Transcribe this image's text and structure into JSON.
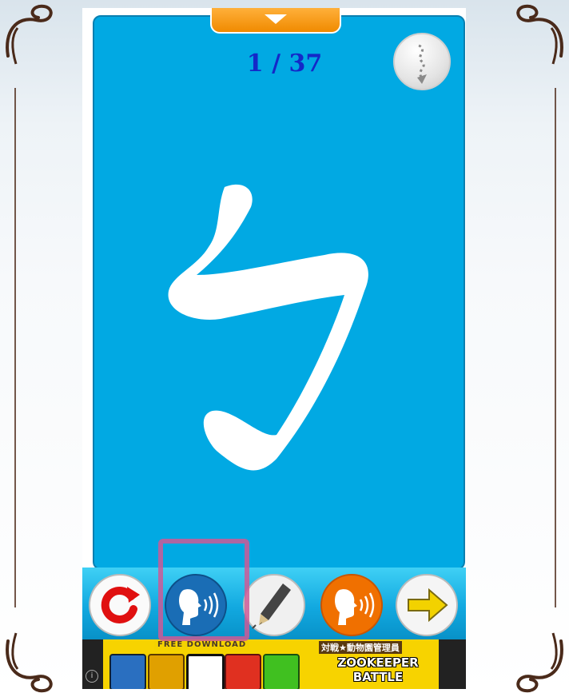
{
  "progress": {
    "current": 1,
    "total": 37,
    "text": "1 / 37"
  },
  "card": {
    "character": "ㄅ",
    "background_color": "#01a9e3",
    "counter_color": "#1428c8"
  },
  "top": {
    "pull_tab_icon": "chevron-down-icon",
    "stroke_order_icon": "stroke-path-icon"
  },
  "toolbar": {
    "buttons": [
      {
        "name": "replay",
        "icon": "replay-icon",
        "color": "#e01010"
      },
      {
        "name": "speak-blue",
        "icon": "speaker-head-icon",
        "color": "#1a6db5"
      },
      {
        "name": "write",
        "icon": "pencil-icon",
        "color": "#e6e6e6"
      },
      {
        "name": "speak-orange",
        "icon": "speaker-head-icon",
        "color": "#f07000"
      },
      {
        "name": "next",
        "icon": "arrow-right-icon",
        "color": "#f2d200"
      }
    ]
  },
  "ad": {
    "free_download": "FREE DOWNLOAD",
    "title_jp": "対戦★動物園管理員",
    "title_line1": "ZOOKEEPER",
    "title_line2": "BATTLE",
    "info": "i"
  }
}
